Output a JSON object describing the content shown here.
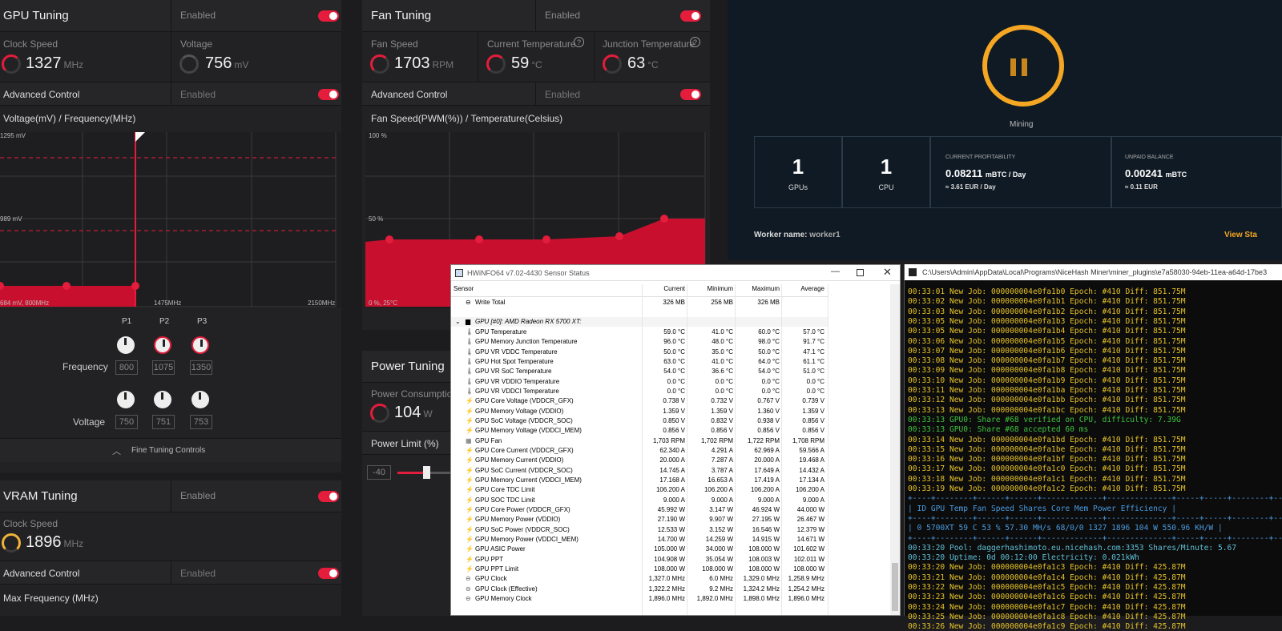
{
  "gpu_tuning": {
    "title": "GPU Tuning",
    "enabled": "Enabled",
    "clock_label": "Clock Speed",
    "clock_value": "1327",
    "clock_unit": "MHz",
    "voltage_label": "Voltage",
    "voltage_value": "756",
    "voltage_unit": "mV",
    "advanced_label": "Advanced Control",
    "advanced_enabled": "Enabled",
    "curve_title": "Voltage(mV) / Frequency(MHz)",
    "y_top": "1295 mV",
    "y_mid": "989 mV",
    "x_left": "684 mV, 800MHz",
    "x_mid": "1475MHz",
    "x_right": "2150MHz",
    "points": [
      "P1",
      "P2",
      "P3"
    ],
    "freq_label": "Frequency",
    "freq_values": [
      "800",
      "1075",
      "1350"
    ],
    "volt_label": "Voltage",
    "volt_values": [
      "750",
      "751",
      "753"
    ],
    "fine_tuning": "Fine Tuning Controls"
  },
  "fan_tuning": {
    "title": "Fan Tuning",
    "enabled": "Enabled",
    "fan_speed_label": "Fan Speed",
    "fan_speed_value": "1703",
    "fan_speed_unit": "RPM",
    "cur_temp_label": "Current Temperature",
    "cur_temp_value": "59",
    "temp_unit": "°C",
    "junction_label": "Junction Temperature",
    "junction_value": "63",
    "advanced_label": "Advanced Control",
    "advanced_enabled": "Enabled",
    "curve_title": "Fan Speed(PWM(%)) / Temperature(Celsius)",
    "y_top": "100 %",
    "y_mid": "50 %",
    "x_left": "0 %, 25°C"
  },
  "power_tuning": {
    "title": "Power Tuning",
    "consumption_label": "Power Consumption",
    "consumption_value": "104",
    "consumption_unit": "W",
    "limit_label": "Power Limit (%)",
    "limit_min": "-40"
  },
  "vram_tuning": {
    "title": "VRAM Tuning",
    "enabled": "Enabled",
    "clock_label": "Clock Speed",
    "clock_value": "1896",
    "clock_unit": "MHz",
    "advanced_label": "Advanced Control",
    "advanced_enabled": "Enabled",
    "max_freq_label": "Max Frequency (MHz)"
  },
  "nicehash": {
    "status": "Mining",
    "gpus_value": "1",
    "gpus_label": "GPUs",
    "cpu_value": "1",
    "cpu_label": "CPU",
    "profit_label": "CURRENT PROFITABILITY",
    "profit_value": "0.08211",
    "profit_unit": "mBTC / Day",
    "profit_eur": "≈ 3.61 EUR / Day",
    "unpaid_label": "UNPAID BALANCE",
    "unpaid_value": "0.00241",
    "unpaid_unit": "mBTC",
    "unpaid_eur": "≈ 0.11 EUR",
    "worker_label": "Worker name:",
    "worker_value": "worker1",
    "view_stats": "View Sta",
    "accent": "#f5a623"
  },
  "hwinfo": {
    "title": "HWiNFO64 v7.02-4430 Sensor Status",
    "columns": [
      "Sensor",
      "Current",
      "Minimum",
      "Maximum",
      "Average"
    ],
    "write_total": [
      "Write Total",
      "326 MB",
      "256 MB",
      "326 MB",
      ""
    ],
    "group": "GPU [#0]: AMD Radeon RX 5700 XT:",
    "rows": [
      [
        "GPU Temperature",
        "59.0 °C",
        "41.0 °C",
        "60.0 °C",
        "57.0 °C"
      ],
      [
        "GPU Memory Junction Temperature",
        "96.0 °C",
        "48.0 °C",
        "98.0 °C",
        "91.7 °C"
      ],
      [
        "GPU VR VDDC Temperature",
        "50.0 °C",
        "35.0 °C",
        "50.0 °C",
        "47.1 °C"
      ],
      [
        "GPU Hot Spot Temperature",
        "63.0 °C",
        "41.0 °C",
        "64.0 °C",
        "61.1 °C"
      ],
      [
        "GPU VR SoC Temperature",
        "54.0 °C",
        "36.6 °C",
        "54.0 °C",
        "51.0 °C"
      ],
      [
        "GPU VR VDDIO Temperature",
        "0.0 °C",
        "0.0 °C",
        "0.0 °C",
        "0.0 °C"
      ],
      [
        "GPU VR VDDCI Temperature",
        "0.0 °C",
        "0.0 °C",
        "0.0 °C",
        "0.0 °C"
      ],
      [
        "GPU Core Voltage (VDDCR_GFX)",
        "0.738 V",
        "0.732 V",
        "0.767 V",
        "0.739 V"
      ],
      [
        "GPU Memory Voltage (VDDIO)",
        "1.359 V",
        "1.359 V",
        "1.360 V",
        "1.359 V"
      ],
      [
        "GPU SoC Voltage (VDDCR_SOC)",
        "0.850 V",
        "0.832 V",
        "0.938 V",
        "0.856 V"
      ],
      [
        "GPU Memory Voltage (VDDCI_MEM)",
        "0.856 V",
        "0.856 V",
        "0.856 V",
        "0.856 V"
      ],
      [
        "GPU Fan",
        "1,703 RPM",
        "1,702 RPM",
        "1,722 RPM",
        "1,708 RPM"
      ],
      [
        "GPU Core Current (VDDCR_GFX)",
        "62.340 A",
        "4.291 A",
        "62.969 A",
        "59.566 A"
      ],
      [
        "GPU Memory Current (VDDIO)",
        "20.000 A",
        "7.287 A",
        "20.000 A",
        "19.468 A"
      ],
      [
        "GPU SoC Current (VDDCR_SOC)",
        "14.745 A",
        "3.787 A",
        "17.649 A",
        "14.432 A"
      ],
      [
        "GPU Memory Current (VDDCI_MEM)",
        "17.168 A",
        "16.653 A",
        "17.419 A",
        "17.134 A"
      ],
      [
        "GPU Core TDC Limit",
        "106.200 A",
        "106.200 A",
        "106.200 A",
        "106.200 A"
      ],
      [
        "GPU SOC TDC Limit",
        "9.000 A",
        "9.000 A",
        "9.000 A",
        "9.000 A"
      ],
      [
        "GPU Core Power (VDDCR_GFX)",
        "45.992 W",
        "3.147 W",
        "46.924 W",
        "44.000 W"
      ],
      [
        "GPU Memory Power (VDDIO)",
        "27.190 W",
        "9.907 W",
        "27.195 W",
        "26.467 W"
      ],
      [
        "GPU SoC Power (VDDCR_SOC)",
        "12.533 W",
        "3.152 W",
        "16.546 W",
        "12.379 W"
      ],
      [
        "GPU Memory Power (VDDCI_MEM)",
        "14.700 W",
        "14.259 W",
        "14.915 W",
        "14.671 W"
      ],
      [
        "GPU ASIC Power",
        "105.000 W",
        "34.000 W",
        "108.000 W",
        "101.602 W"
      ],
      [
        "GPU PPT",
        "104.908 W",
        "35.054 W",
        "108.003 W",
        "102.011 W"
      ],
      [
        "GPU PPT Limit",
        "108.000 W",
        "108.000 W",
        "108.000 W",
        "108.000 W"
      ],
      [
        "GPU Clock",
        "1,327.0 MHz",
        "6.0 MHz",
        "1,329.0 MHz",
        "1,258.9 MHz"
      ],
      [
        "GPU Clock (Effective)",
        "1,322.2 MHz",
        "9.2 MHz",
        "1,324.2 MHz",
        "1,254.2 MHz"
      ],
      [
        "GPU Memory Clock",
        "1,896.0 MHz",
        "1,892.0 MHz",
        "1,898.0 MHz",
        "1,896.0 MHz"
      ]
    ]
  },
  "console": {
    "title": "C:\\Users\\Admin\\AppData\\Local\\Programs\\NiceHash Miner\\miner_plugins\\e7a58030-94eb-11ea-a64d-17be3",
    "lines": [
      {
        "c": "y",
        "t": "00:33:01 New Job: 000000004e0fa1b0 Epoch: #410 Diff: 851.75M"
      },
      {
        "c": "y",
        "t": "00:33:02 New Job: 000000004e0fa1b1 Epoch: #410 Diff: 851.75M"
      },
      {
        "c": "y",
        "t": "00:33:03 New Job: 000000004e0fa1b2 Epoch: #410 Diff: 851.75M"
      },
      {
        "c": "y",
        "t": "00:33:05 New Job: 000000004e0fa1b3 Epoch: #410 Diff: 851.75M"
      },
      {
        "c": "y",
        "t": "00:33:05 New Job: 000000004e0fa1b4 Epoch: #410 Diff: 851.75M"
      },
      {
        "c": "y",
        "t": "00:33:06 New Job: 000000004e0fa1b5 Epoch: #410 Diff: 851.75M"
      },
      {
        "c": "y",
        "t": "00:33:07 New Job: 000000004e0fa1b6 Epoch: #410 Diff: 851.75M"
      },
      {
        "c": "y",
        "t": "00:33:08 New Job: 000000004e0fa1b7 Epoch: #410 Diff: 851.75M"
      },
      {
        "c": "y",
        "t": "00:33:09 New Job: 000000004e0fa1b8 Epoch: #410 Diff: 851.75M"
      },
      {
        "c": "y",
        "t": "00:33:10 New Job: 000000004e0fa1b9 Epoch: #410 Diff: 851.75M"
      },
      {
        "c": "y",
        "t": "00:33:11 New Job: 000000004e0fa1ba Epoch: #410 Diff: 851.75M"
      },
      {
        "c": "y",
        "t": "00:33:12 New Job: 000000004e0fa1bb Epoch: #410 Diff: 851.75M"
      },
      {
        "c": "y",
        "t": "00:33:13 New Job: 000000004e0fa1bc Epoch: #410 Diff: 851.75M"
      },
      {
        "c": "g",
        "t": "00:33:13 GPU0: Share #68 verified on CPU, difficulty: 7.39G"
      },
      {
        "c": "g",
        "t": "00:33:13 GPU0: Share #68 accepted 60 ms"
      },
      {
        "c": "y",
        "t": "00:33:14 New Job: 000000004e0fa1bd Epoch: #410 Diff: 851.75M"
      },
      {
        "c": "y",
        "t": "00:33:15 New Job: 000000004e0fa1be Epoch: #410 Diff: 851.75M"
      },
      {
        "c": "y",
        "t": "00:33:16 New Job: 000000004e0fa1bf Epoch: #410 Diff: 851.75M"
      },
      {
        "c": "y",
        "t": "00:33:17 New Job: 000000004e0fa1c0 Epoch: #410 Diff: 851.75M"
      },
      {
        "c": "y",
        "t": "00:33:18 New Job: 000000004e0fa1c1 Epoch: #410 Diff: 851.75M"
      },
      {
        "c": "y",
        "t": "00:33:19 New Job: 000000004e0fa1c2 Epoch: #410 Diff: 851.75M"
      },
      {
        "c": "b",
        "t": "+----+--------+------+------+-------------+--------------+-----+-----+--------+------------+"
      },
      {
        "c": "b",
        "t": "| ID  GPU  Temp  Fan    Speed   Shares Core  Mem  Power  Efficiency |"
      },
      {
        "c": "b",
        "t": "+----+--------+------+------+-------------+--------------+-----+-----+--------+------------+"
      },
      {
        "c": "b",
        "t": "|  0  5700XT 59 C  53 %  57.30 MH/s 68/0/0 1327  1896 104 W  550.96 KH/W |"
      },
      {
        "c": "b",
        "t": "+----+--------+------+------+-------------+--------------+-----+-----+--------+------------+"
      },
      {
        "c": "c",
        "t": "00:33:20 Pool: daggerhashimoto.eu.nicehash.com:3353 Shares/Minute: 5.67"
      },
      {
        "c": "c",
        "t": "00:33:20 Uptime: 0d 00:12:00 Electricity: 0.021kWh"
      },
      {
        "c": "y",
        "t": "00:33:20 New Job: 000000004e0fa1c3 Epoch: #410 Diff: 425.87M"
      },
      {
        "c": "y",
        "t": "00:33:21 New Job: 000000004e0fa1c4 Epoch: #410 Diff: 425.87M"
      },
      {
        "c": "y",
        "t": "00:33:22 New Job: 000000004e0fa1c5 Epoch: #410 Diff: 425.87M"
      },
      {
        "c": "y",
        "t": "00:33:23 New Job: 000000004e0fa1c6 Epoch: #410 Diff: 425.87M"
      },
      {
        "c": "y",
        "t": "00:33:24 New Job: 000000004e0fa1c7 Epoch: #410 Diff: 425.87M"
      },
      {
        "c": "y",
        "t": "00:33:25 New Job: 000000004e0fa1c8 Epoch: #410 Diff: 425.87M"
      },
      {
        "c": "y",
        "t": "00:33:26 New Job: 000000004e0fa1c9 Epoch: #410 Diff: 425.87M"
      }
    ]
  }
}
